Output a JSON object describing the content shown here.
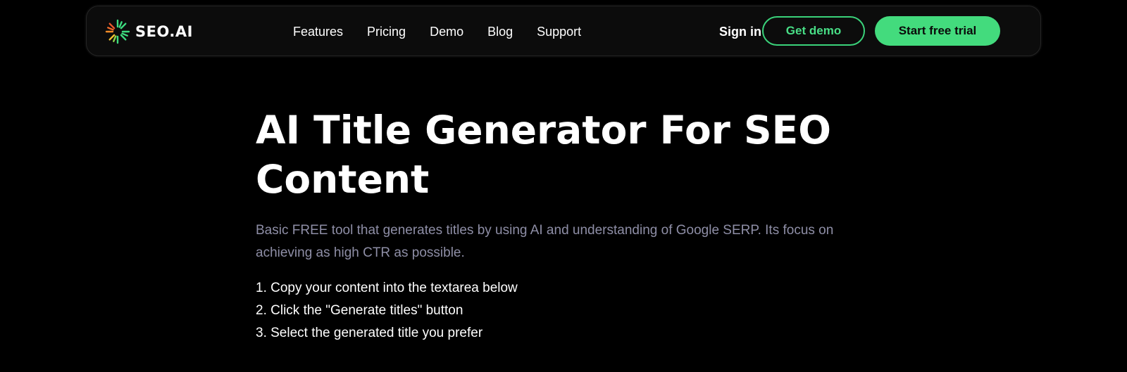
{
  "nav": {
    "logo_text": "SEO.AI",
    "links": [
      "Features",
      "Pricing",
      "Demo",
      "Blog",
      "Support"
    ],
    "sign_in": "Sign in",
    "get_demo": "Get demo",
    "start_trial": "Start free trial"
  },
  "hero": {
    "title_line1": "AI Title Generator For SEO",
    "title_line2": "Content",
    "subtitle": "Basic FREE tool that generates titles by using AI and understanding of Google SERP. Its focus on achieving as high CTR as possible.",
    "steps": [
      "1. Copy your content into the textarea below",
      "2. Click the \"Generate titles\" button",
      "3. Select the generated title you prefer"
    ]
  },
  "colors": {
    "background": "#000000",
    "navbar": "#0c0c0c",
    "accent_green": "#43db7d",
    "subtitle_gray": "#8e8ea6"
  },
  "icons": {
    "logo_mark": "sunburst-logo-icon"
  }
}
